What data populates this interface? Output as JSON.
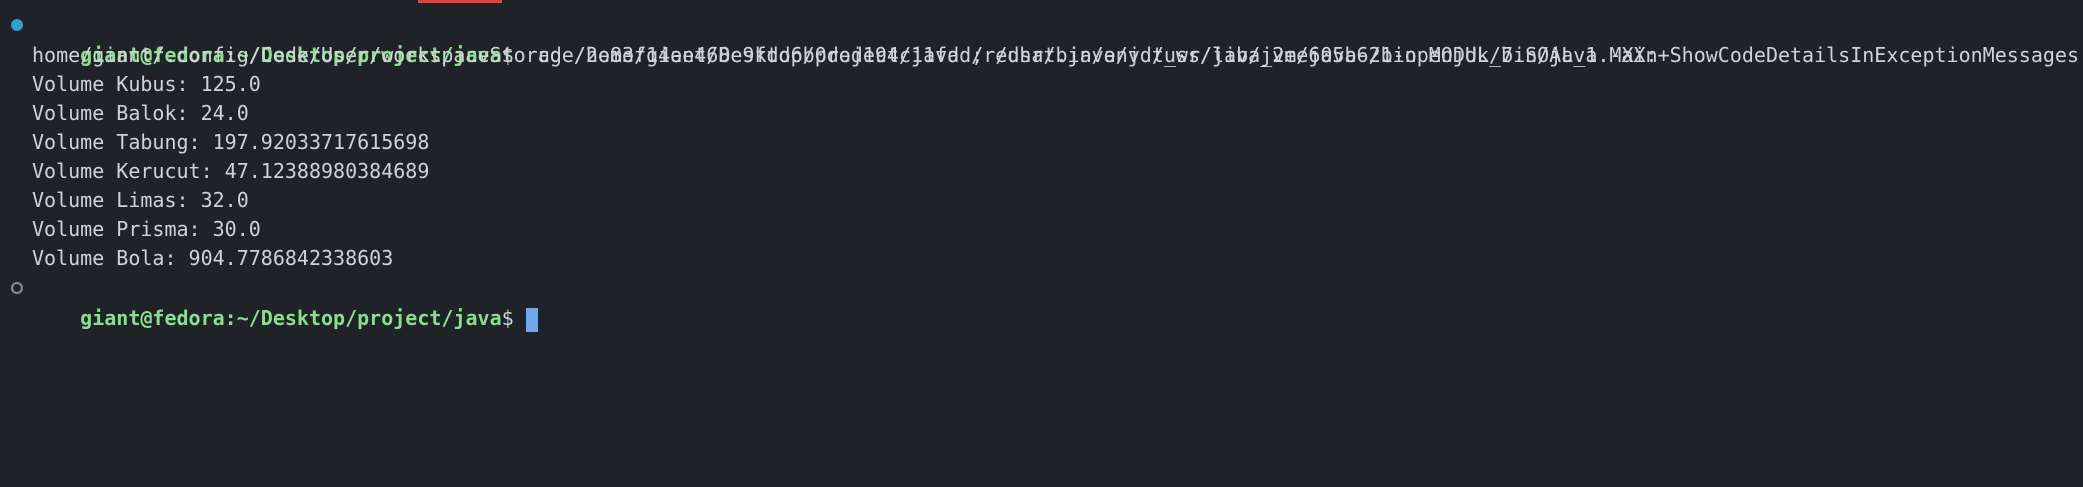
{
  "terminal": {
    "accent_colors": {
      "prompt": "#88e08e",
      "cursor": "#6fa8ee",
      "success_marker": "#2f9fd1",
      "tab_indicator": "#e0443a"
    },
    "run": {
      "prompt_user_host": "giant@fedora",
      "prompt_path": ":~/Desktop/project/java",
      "prompt_sign": "$",
      "command_line_1": "  cd /home/giant/Desktop/project/java ; /usr/bin/env /usr/lib/jvm/java-21-openjdk/bin/java -XX:+ShowCodeDetailsInExceptionMessages -cp",
      "command_line_2": "home/giant/.config/Code/User/workspaceStorage/2e83f14ee468e9fdd6b0ded194c11fdd/redhat.java/jdt_ws/java_2ee605b6/bin MODUL_7.SOAL_1.Main"
    },
    "output": [
      "Volume Kubus: 125.0",
      "Volume Balok: 24.0",
      "Volume Tabung: 197.92033717615698",
      "Volume Kerucut: 47.12388980384689",
      "Volume Limas: 32.0",
      "Volume Prisma: 30.0",
      "Volume Bola: 904.7786842338603"
    ],
    "next_prompt": {
      "prompt_user_host": "giant@fedora",
      "prompt_path": ":~/Desktop/project/java",
      "prompt_sign": "$"
    }
  }
}
